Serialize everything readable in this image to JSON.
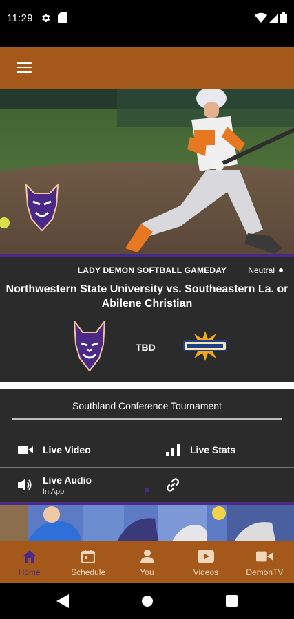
{
  "status_bar": {
    "time": "11:29"
  },
  "app_bar": {
    "menu_icon": "hamburger-menu-icon"
  },
  "game": {
    "event": "LADY DEMON SOFTBALL GAMEDAY",
    "site": "Neutral",
    "title": "Northwestern State University vs. Southeastern La. or Abilene Christian",
    "result": "TBD"
  },
  "links_panel": {
    "title": "Southland Conference Tournament",
    "items": [
      {
        "label": "Live Video",
        "icon": "video-camera-icon"
      },
      {
        "label": "Live Stats",
        "icon": "bar-chart-icon"
      },
      {
        "label": "Live Audio",
        "sublabel": "In App",
        "icon": "speaker-icon"
      },
      {
        "label": "",
        "icon": "link-icon"
      }
    ]
  },
  "bottom_nav": {
    "items": [
      {
        "label": "Home",
        "icon": "home-icon",
        "active": true
      },
      {
        "label": "Schedule",
        "icon": "calendar-icon",
        "active": false
      },
      {
        "label": "You",
        "icon": "person-icon",
        "active": false
      },
      {
        "label": "Videos",
        "icon": "play-icon",
        "active": false
      },
      {
        "label": "DemonTV",
        "icon": "video-camera-icon",
        "active": false
      }
    ]
  },
  "colors": {
    "brand_orange": "#a4591a",
    "brand_purple": "#4a2a86",
    "card_bg": "#2b2b2b"
  }
}
